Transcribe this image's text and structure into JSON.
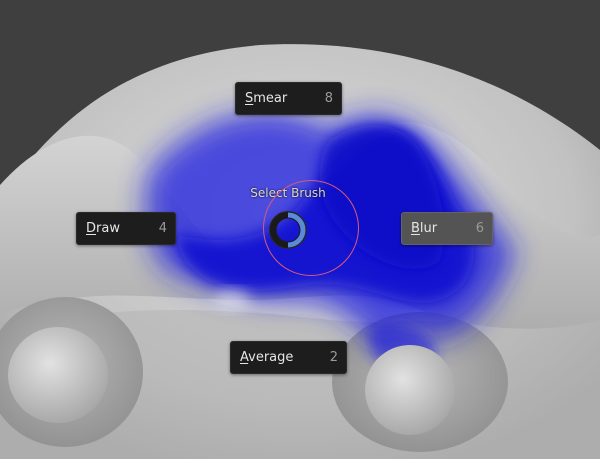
{
  "pie_menu": {
    "title": "Select Brush",
    "items": [
      {
        "accel": "S",
        "rest": "mear",
        "key": "8",
        "active": false
      },
      {
        "accel": "D",
        "rest": "raw",
        "key": "4",
        "active": false
      },
      {
        "accel": "B",
        "rest": "lur",
        "key": "6",
        "active": true
      },
      {
        "accel": "A",
        "rest": "verage",
        "key": "2",
        "active": false
      }
    ]
  },
  "colors": {
    "background": "#3f3f3f",
    "mesh": "#c4c4c4",
    "mask_blue": "#1a1ae0",
    "ring": "#d85a7a",
    "item_bg": "#1d1d1d",
    "item_active_bg": "#545454",
    "indicator_accent": "#5a8ad8"
  }
}
